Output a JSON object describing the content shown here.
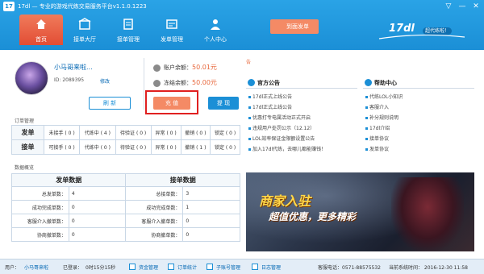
{
  "window": {
    "logo": "17",
    "title": "17dl — 专业的游戏代练交易服务平台v1.1.0.1223",
    "controls": [
      "▽",
      "—",
      "✕"
    ]
  },
  "nav": {
    "items": [
      {
        "label": "首页",
        "icon": "home-icon",
        "active": true
      },
      {
        "label": "接单大厅",
        "icon": "hall-icon"
      },
      {
        "label": "接单管理",
        "icon": "receive-manage-icon"
      },
      {
        "label": "发单管理",
        "icon": "send-manage-icon"
      },
      {
        "label": "个人中心",
        "icon": "user-center-icon"
      }
    ],
    "sign_label": "到面发单",
    "brand_name": "17dl",
    "brand_slogan": "超代练啦！"
  },
  "user": {
    "name": "小马哥来啦...",
    "id_text": "ID: 2089395",
    "modify_label": "修改",
    "refresh_label": "刷 新",
    "balance_label": "账户余额：",
    "balance_value": "50.01元",
    "frozen_label": "冻结余额：",
    "frozen_value": "50.00元",
    "recharge_label": "充 值",
    "withdraw_label": "提 现"
  },
  "orders": {
    "title": "订单管理",
    "rows": [
      {
        "head": "发单",
        "cells": [
          "未接手 ( 0 )",
          "代练中 ( 4 )",
          "待验证 ( 0 )",
          "异常 ( 0 )",
          "撤销 ( 0 )",
          "锁定 ( 0 )"
        ]
      },
      {
        "head": "接单",
        "cells": [
          "可接手 ( 0 )",
          "代练中 ( 0 )",
          "待验证 ( 0 )",
          "异常 ( 0 )",
          "撤销 ( 1 )",
          "锁定 ( 0 )"
        ]
      }
    ]
  },
  "overview": {
    "title": "数据概览",
    "send_head": "发单数据",
    "recv_head": "接单数据",
    "rows": [
      {
        "l1": "总发单数：",
        "v1": "4",
        "l2": "总接单数：",
        "v2": "3"
      },
      {
        "l1": "成功完成单数：",
        "v1": "0",
        "l2": "成功完成单数：",
        "v2": "1"
      },
      {
        "l1": "客服介入撤单数：",
        "v1": "0",
        "l2": "客服介入撤单数：",
        "v2": "0"
      },
      {
        "l1": "协商撤单数：",
        "v1": "0",
        "l2": "协商撤单数：",
        "v2": "0"
      }
    ]
  },
  "right": {
    "strip_text": "告",
    "announce_title": "官方公告",
    "announce_items": [
      "17dl正式上线公告",
      "17dl正式上线公告",
      "优惠打专电属活动正式开启",
      "违规用户处罚公示（12.12）",
      "LOL效率保证金限额设置公告",
      "加入17dl代练，去哪儿都能赚钱！"
    ],
    "help_title": "帮助中心",
    "help_items": [
      "代练LOL小知识",
      "客服介入",
      "补分规则说明",
      "17dl介绍",
      "接单协议",
      "发单协议"
    ],
    "banner_line1": "商家入驻",
    "banner_line2": "超值优惠，更多精彩"
  },
  "status": {
    "user_label": "用户：",
    "user_name": "小马哥来啦",
    "login_label": "已登录：",
    "login_time": "0时15分15秒",
    "funds": "资金管理",
    "order_stats": "订单统计",
    "sub_accounts": "子账号管理",
    "logs": "日志管理",
    "phone": "客服电话：0571-88575532",
    "sys_time": "当前系统时间：  2016-12-30 11:58"
  }
}
